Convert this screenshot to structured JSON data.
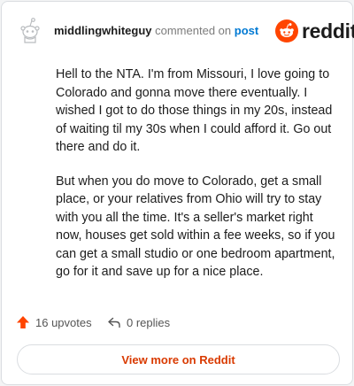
{
  "header": {
    "username": "middlingwhiteguy",
    "action_text": "commented on",
    "post_link": "post",
    "brand": "reddit"
  },
  "comment": {
    "paragraphs": [
      "Hell to the NTA. I'm from Missouri, I love going to Colorado and gonna move there eventually. I wished I got to do those things in my 20s, instead of waiting til my 30s when I could afford it. Go out there and do it.",
      "But when you do move to Colorado, get a small place, or your relatives from Ohio will try to stay with you all the time. It's a seller's market right now, houses get sold within a fee weeks, so if you can get a small studio or one bedroom apartment, go for it and save up for a nice place."
    ]
  },
  "actions": {
    "upvotes": "16 upvotes",
    "replies": "0 replies"
  },
  "footer": {
    "view_more": "View more on Reddit"
  },
  "icons": {
    "avatar": "snoo-avatar-icon",
    "brand": "reddit-logo-icon",
    "upvote": "upvote-arrow-icon",
    "reply": "reply-arrow-icon"
  },
  "colors": {
    "brand_orange": "#ff4500",
    "link_blue": "#0079d3",
    "cta_text": "#d93a00"
  }
}
